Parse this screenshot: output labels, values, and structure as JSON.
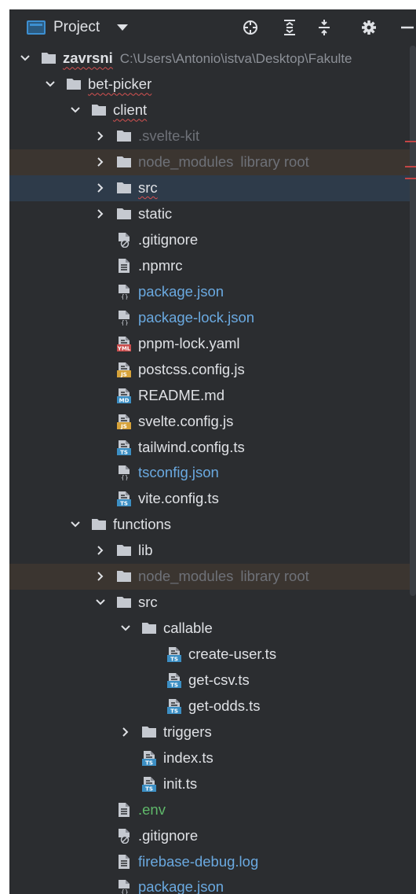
{
  "toolbar": {
    "title": "Project",
    "icons": [
      "locate-icon",
      "expand-all-icon",
      "collapse-all-icon",
      "settings-icon",
      "minimize-icon"
    ]
  },
  "colors": {
    "panel_bg": "#2b2d30",
    "folder": "#c5c9d0",
    "excluded_bg": "#3b3530",
    "selected_bg": "#2e3b4a",
    "vcs_blue": "#6aa9e0",
    "vcs_green": "#5fb86a",
    "muted": "#6e7178"
  },
  "tree": [
    {
      "label": "zavrsni",
      "hint": "C:\\Users\\Antonio\\istva\\Desktop\\Fakulte",
      "indent": 0,
      "type": "folder",
      "chevron": "down",
      "style": "bold"
    },
    {
      "label": "bet-picker",
      "indent": 1,
      "type": "folder",
      "chevron": "down",
      "style": "under"
    },
    {
      "label": "client",
      "indent": 2,
      "type": "folder",
      "chevron": "down",
      "style": "under"
    },
    {
      "label": ".svelte-kit",
      "indent": 3,
      "type": "folder",
      "chevron": "right",
      "style": "muted"
    },
    {
      "label": "node_modules",
      "hint": "library root",
      "indent": 3,
      "type": "folder",
      "chevron": "right",
      "style": "muted",
      "bg": "excluded"
    },
    {
      "label": "src",
      "indent": 3,
      "type": "folder",
      "chevron": "right",
      "style": "under",
      "bg": "selected"
    },
    {
      "label": "static",
      "indent": 3,
      "type": "folder",
      "chevron": "right",
      "style": "normal"
    },
    {
      "label": ".gitignore",
      "indent": 3,
      "type": "ignore",
      "style": "normal"
    },
    {
      "label": ".npmrc",
      "indent": 3,
      "type": "text",
      "style": "normal"
    },
    {
      "label": "package.json",
      "indent": 3,
      "type": "json",
      "style": "blue"
    },
    {
      "label": "package-lock.json",
      "indent": 3,
      "type": "json",
      "style": "blue"
    },
    {
      "label": "pnpm-lock.yaml",
      "indent": 3,
      "type": "yml",
      "badge": "YML",
      "style": "normal"
    },
    {
      "label": "postcss.config.js",
      "indent": 3,
      "type": "js",
      "badge": "JS",
      "style": "normal"
    },
    {
      "label": "README.md",
      "indent": 3,
      "type": "md",
      "badge": "MD",
      "style": "normal"
    },
    {
      "label": "svelte.config.js",
      "indent": 3,
      "type": "js",
      "badge": "JS",
      "style": "normal"
    },
    {
      "label": "tailwind.config.ts",
      "indent": 3,
      "type": "ts",
      "badge": "TS",
      "style": "normal"
    },
    {
      "label": "tsconfig.json",
      "indent": 3,
      "type": "json",
      "style": "blue"
    },
    {
      "label": "vite.config.ts",
      "indent": 3,
      "type": "ts",
      "badge": "TS",
      "style": "normal"
    },
    {
      "label": "functions",
      "indent": 2,
      "type": "folder",
      "chevron": "down",
      "style": "normal"
    },
    {
      "label": "lib",
      "indent": 3,
      "type": "folder",
      "chevron": "right",
      "style": "normal"
    },
    {
      "label": "node_modules",
      "hint": "library root",
      "indent": 3,
      "type": "folder",
      "chevron": "right",
      "style": "muted",
      "bg": "excluded"
    },
    {
      "label": "src",
      "indent": 3,
      "type": "folder",
      "chevron": "down",
      "style": "normal"
    },
    {
      "label": "callable",
      "indent": 4,
      "type": "folder",
      "chevron": "down",
      "style": "normal"
    },
    {
      "label": "create-user.ts",
      "indent": 5,
      "type": "ts",
      "badge": "TS",
      "style": "normal"
    },
    {
      "label": "get-csv.ts",
      "indent": 5,
      "type": "ts",
      "badge": "TS",
      "style": "normal"
    },
    {
      "label": "get-odds.ts",
      "indent": 5,
      "type": "ts",
      "badge": "TS",
      "style": "normal"
    },
    {
      "label": "triggers",
      "indent": 4,
      "type": "folder",
      "chevron": "right",
      "style": "normal"
    },
    {
      "label": "index.ts",
      "indent": 4,
      "type": "ts",
      "badge": "TS",
      "style": "normal"
    },
    {
      "label": "init.ts",
      "indent": 4,
      "type": "ts",
      "badge": "TS",
      "style": "normal"
    },
    {
      "label": ".env",
      "indent": 3,
      "type": "text",
      "style": "green"
    },
    {
      "label": ".gitignore",
      "indent": 3,
      "type": "ignore",
      "style": "normal"
    },
    {
      "label": "firebase-debug.log",
      "indent": 3,
      "type": "text",
      "style": "blue"
    },
    {
      "label": "package.json",
      "indent": 3,
      "type": "json",
      "style": "blue"
    }
  ]
}
